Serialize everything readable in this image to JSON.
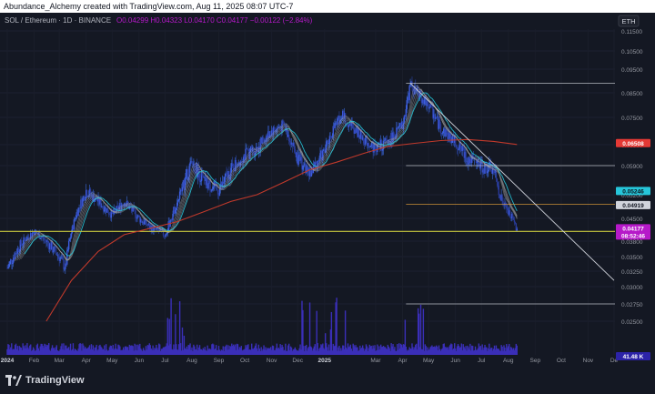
{
  "header": {
    "text": "Abundance_Alchemy created with TradingView.com, Aug 11, 2025 08:07 UTC-7"
  },
  "symbol_line": {
    "name": "SOL / Ethereum · 1D · BINANCE",
    "ohlc": "O0.04299 H0.04323 L0.04170 C0.04177 −0.00122 (−2.84%)"
  },
  "currency_button": "ETH",
  "footer": {
    "brand": "TradingView"
  },
  "colors": {
    "background": "#141823",
    "candle": "#3d5ce0",
    "ma_red": "#c0392b",
    "ma_teal": "#26c6da",
    "ribbon": "#9e9e9e",
    "volume": "#3a2fb8",
    "price_badge": "#b619c9",
    "ma_badge": "#e53935",
    "teal_badge": "#26c6da",
    "level_orange": "#e6a23c",
    "level_yellow": "#c9c83e",
    "level_white": "#d1d4dc"
  },
  "chart_data": {
    "type": "candlestick",
    "pair": "SOL/ETH",
    "timeframe": "1D",
    "x_ticks": [
      "2024",
      "Feb",
      "Mar",
      "Apr",
      "May",
      "Jun",
      "Jul",
      "Aug",
      "Sep",
      "Oct",
      "Nov",
      "Dec",
      "2025",
      "Mar",
      "Apr",
      "May",
      "Jun",
      "Jul",
      "Aug",
      "Sep",
      "Oct",
      "Nov",
      "De"
    ],
    "y_ticks": [
      "0.11500",
      "0.10500",
      "0.09500",
      "0.08500",
      "0.07500",
      "0.06500",
      "0.05900",
      "0.05200",
      "0.04500",
      "0.03800",
      "0.03500",
      "0.03250",
      "0.03000",
      "0.02750",
      "0.02500"
    ],
    "price_series": [
      [
        "2024-01-01",
        0.033
      ],
      [
        "2024-01-15",
        0.037
      ],
      [
        "2024-02-01",
        0.041
      ],
      [
        "2024-02-15",
        0.038
      ],
      [
        "2024-03-01",
        0.035
      ],
      [
        "2024-03-08",
        0.033
      ],
      [
        "2024-03-20",
        0.046
      ],
      [
        "2024-04-01",
        0.053
      ],
      [
        "2024-04-15",
        0.05
      ],
      [
        "2024-05-01",
        0.046
      ],
      [
        "2024-05-15",
        0.05
      ],
      [
        "2024-06-01",
        0.045
      ],
      [
        "2024-06-15",
        0.042
      ],
      [
        "2024-07-01",
        0.04
      ],
      [
        "2024-07-15",
        0.05
      ],
      [
        "2024-08-01",
        0.06
      ],
      [
        "2024-08-15",
        0.055
      ],
      [
        "2024-09-01",
        0.053
      ],
      [
        "2024-09-15",
        0.058
      ],
      [
        "2024-10-01",
        0.062
      ],
      [
        "2024-10-15",
        0.064
      ],
      [
        "2024-11-01",
        0.07
      ],
      [
        "2024-11-15",
        0.072
      ],
      [
        "2024-12-01",
        0.061
      ],
      [
        "2024-12-15",
        0.057
      ],
      [
        "2025-01-01",
        0.063
      ],
      [
        "2025-01-10",
        0.07
      ],
      [
        "2025-01-20",
        0.076
      ],
      [
        "2025-02-01",
        0.072
      ],
      [
        "2025-02-15",
        0.067
      ],
      [
        "2025-03-01",
        0.064
      ],
      [
        "2025-03-15",
        0.066
      ],
      [
        "2025-04-01",
        0.072
      ],
      [
        "2025-04-10",
        0.088
      ],
      [
        "2025-04-20",
        0.084
      ],
      [
        "2025-05-01",
        0.08
      ],
      [
        "2025-05-15",
        0.071
      ],
      [
        "2025-06-01",
        0.066
      ],
      [
        "2025-06-15",
        0.061
      ],
      [
        "2025-07-01",
        0.059
      ],
      [
        "2025-07-15",
        0.058
      ],
      [
        "2025-07-25",
        0.05
      ],
      [
        "2025-08-05",
        0.045
      ],
      [
        "2025-08-11",
        0.04177
      ]
    ],
    "ma_red_series": [
      [
        "2024-02-15",
        0.025
      ],
      [
        "2024-03-15",
        0.031
      ],
      [
        "2024-04-15",
        0.036
      ],
      [
        "2024-05-15",
        0.04
      ],
      [
        "2024-06-15",
        0.042
      ],
      [
        "2024-07-15",
        0.044
      ],
      [
        "2024-08-15",
        0.047
      ],
      [
        "2024-09-15",
        0.05
      ],
      [
        "2024-10-15",
        0.052
      ],
      [
        "2024-11-15",
        0.055
      ],
      [
        "2024-12-15",
        0.058
      ],
      [
        "2025-01-15",
        0.06
      ],
      [
        "2025-02-15",
        0.0625
      ],
      [
        "2025-03-15",
        0.0645
      ],
      [
        "2025-04-15",
        0.0655
      ],
      [
        "2025-05-15",
        0.0665
      ],
      [
        "2025-06-15",
        0.0669
      ],
      [
        "2025-07-15",
        0.0662
      ],
      [
        "2025-08-11",
        0.06508
      ]
    ],
    "horizontal_levels": [
      {
        "value": 0.089,
        "color": "white"
      },
      {
        "value": 0.059,
        "color": "white"
      },
      {
        "value": 0.0492,
        "color": "orange"
      },
      {
        "value": 0.041,
        "color": "yellow"
      },
      {
        "value": 0.0275,
        "color": "white"
      }
    ],
    "trendline": {
      "from": [
        "2025-04-10",
        0.089
      ],
      "to": [
        "2025-12-01",
        0.031
      ]
    },
    "price_labels": [
      {
        "text": "0.06508",
        "kind": "ma_red"
      },
      {
        "text": "0.05246",
        "kind": "teal"
      },
      {
        "text": "0.04919",
        "kind": "level"
      },
      {
        "text": "0.04177",
        "kind": "price"
      },
      {
        "text": "08:52:46",
        "kind": "countdown"
      }
    ],
    "volume_label": "41.48 K",
    "volume_spike_months": [
      "2024-07",
      "2024-12",
      "2025-01",
      "2025-04"
    ]
  }
}
